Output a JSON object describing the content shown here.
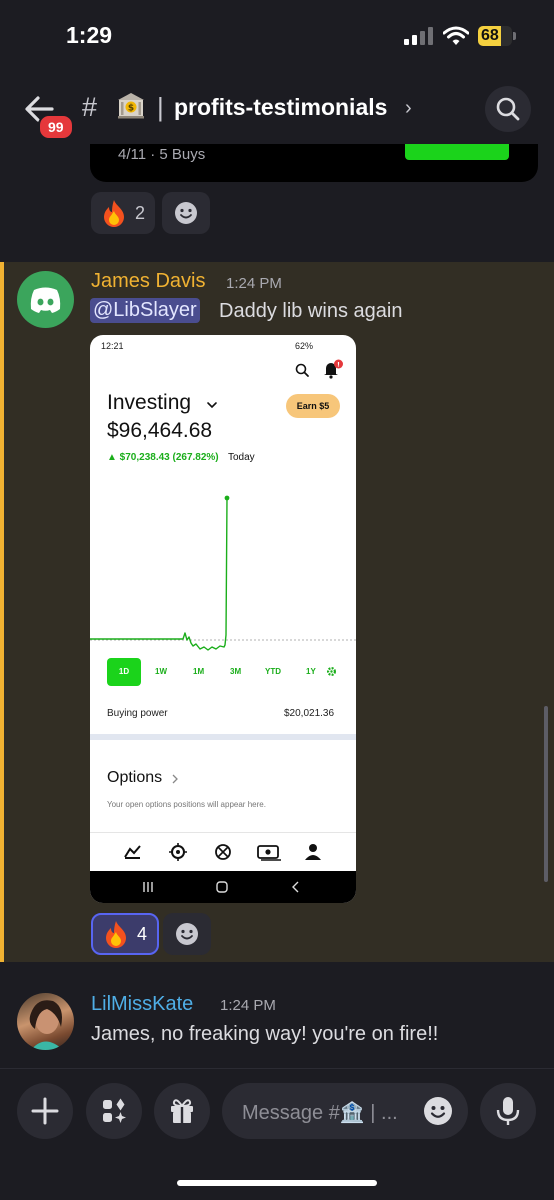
{
  "status_bar": {
    "time": "1:29",
    "battery": "68",
    "battery_level": 0.68
  },
  "header": {
    "unread_count": "99",
    "hash": "#",
    "separator": "|",
    "channel_name": "profits-testimonials",
    "chevron": "›"
  },
  "previous_message": {
    "embed_meta": "4/11 · 5 Buys",
    "reactions": [
      {
        "emoji": "fire",
        "count": "2"
      }
    ]
  },
  "messages": [
    {
      "author": "James Davis",
      "time": "1:24 PM",
      "mention": "@LibSlayer",
      "text": "Daddy lib wins again",
      "reactions": [
        {
          "emoji": "fire",
          "count": "4",
          "selected": true
        }
      ],
      "attachment": {
        "status_time": "12:21",
        "status_battery": "62%",
        "title": "Investing",
        "balance": "$96,464.68",
        "gain": "▲ $70,238.43 (267.82%)",
        "gain_period": "Today",
        "earn_button": "Earn $5",
        "ranges": [
          "1D",
          "1W",
          "1M",
          "3M",
          "YTD",
          "1Y"
        ],
        "selected_range": "1D",
        "buying_power_label": "Buying power",
        "buying_power_value": "$20,021.36",
        "options_title": "Options",
        "options_subtitle": "Your open options positions will appear here."
      }
    },
    {
      "author": "LilMissKate",
      "time": "1:24 PM",
      "text": "James, no freaking way! you're on fire!!"
    }
  ],
  "composer": {
    "placeholder": "Message #🏦 | ..."
  },
  "colors": {
    "accent_mention": "#f0b232",
    "name_kate": "#4faee6",
    "robinhood_green": "#1bd31b",
    "badge_red": "#e5383b"
  }
}
